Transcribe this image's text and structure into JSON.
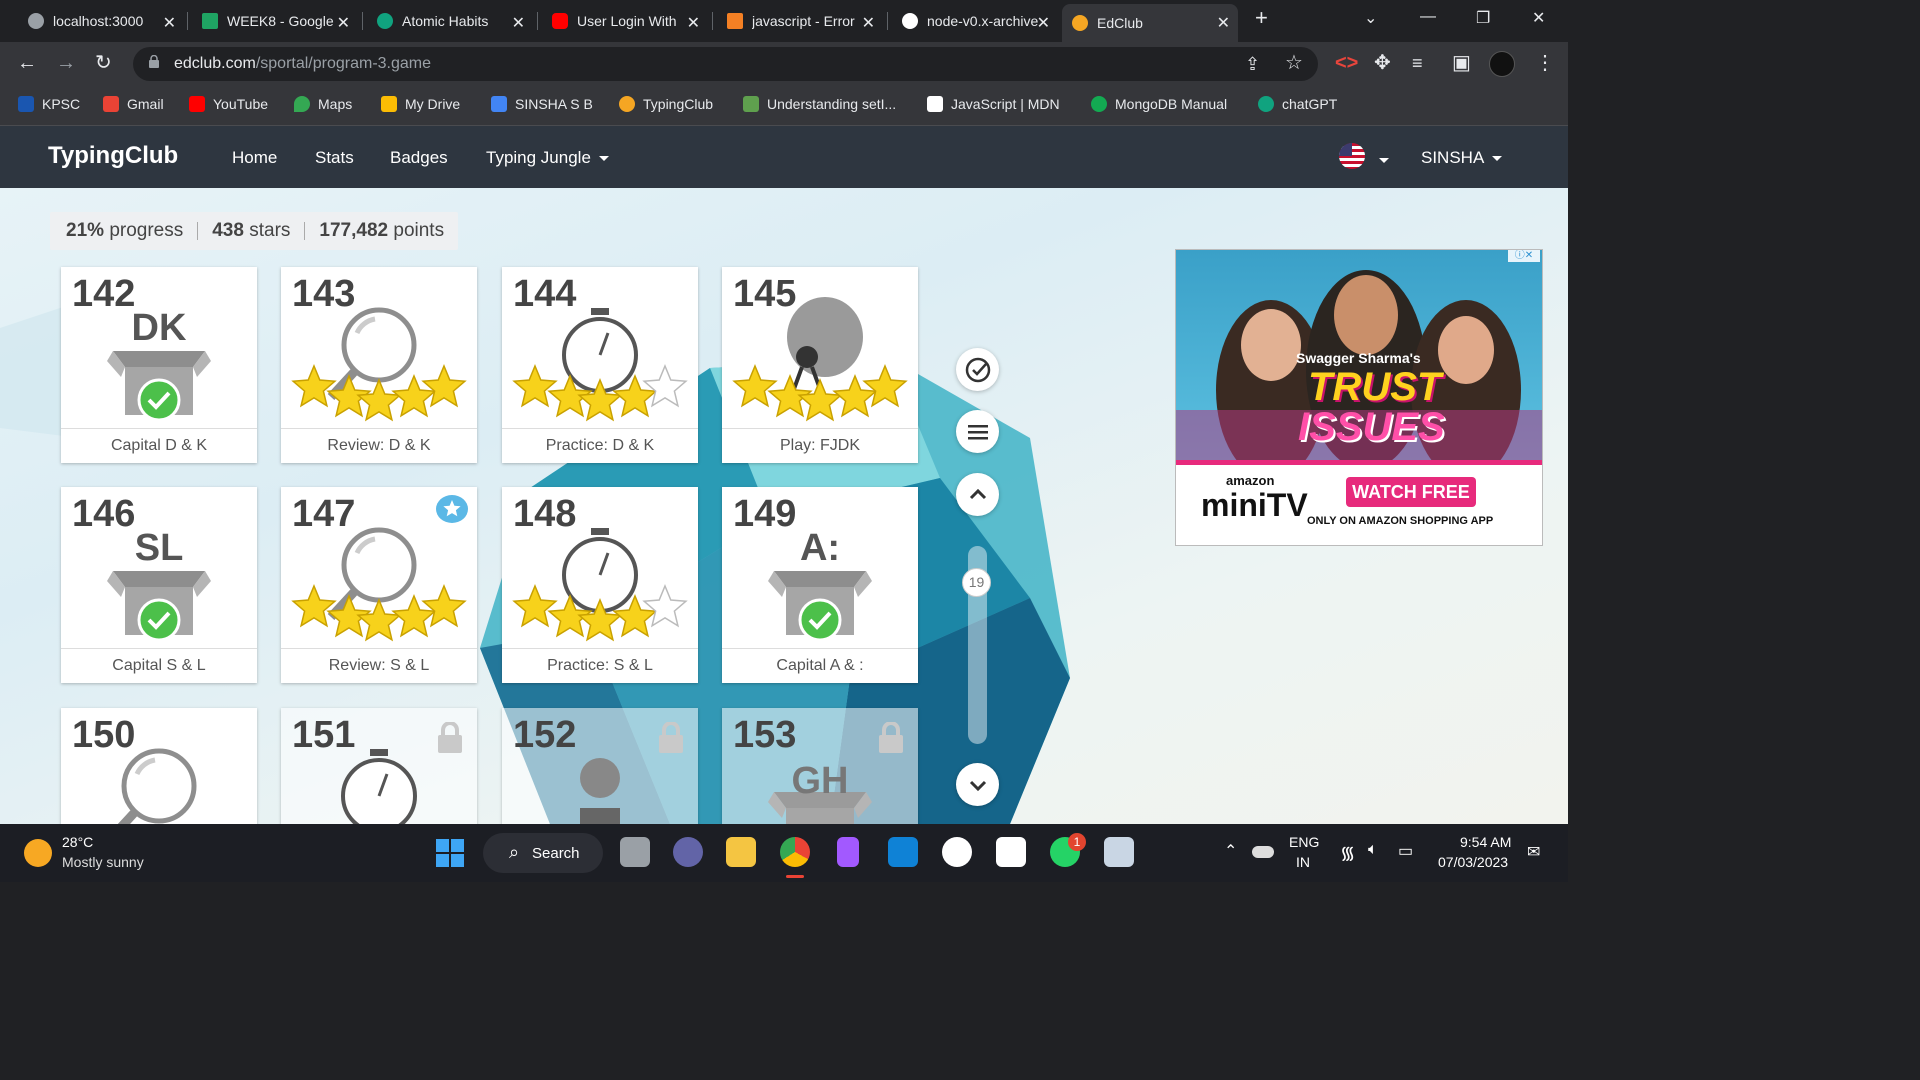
{
  "browser": {
    "tabs": [
      {
        "title": "localhost:3000",
        "color": "#9aa0a6"
      },
      {
        "title": "WEEK8 - Google",
        "color": "#1fa463"
      },
      {
        "title": "Atomic Habits",
        "color": "#10a37f"
      },
      {
        "title": "User Login With",
        "color": "#ff0000"
      },
      {
        "title": "javascript - Error",
        "color": "#f48024"
      },
      {
        "title": "node-v0.x-archive",
        "color": "#ffffff"
      },
      {
        "title": "EdClub",
        "color": "#f5a623"
      }
    ],
    "url_domain": "edclub.com",
    "url_path": "/sportal/program-3.game",
    "bookmarks": [
      {
        "label": "KPSC",
        "color": "#1a56b0"
      },
      {
        "label": "Gmail",
        "color": "#ea4335"
      },
      {
        "label": "YouTube",
        "color": "#ff0000"
      },
      {
        "label": "Maps",
        "color": "#34a853"
      },
      {
        "label": "My Drive",
        "color": "#fbbc04"
      },
      {
        "label": "SINSHA S B",
        "color": "#4285f4"
      },
      {
        "label": "TypingClub",
        "color": "#f5a623"
      },
      {
        "label": "Understanding setI...",
        "color": "#5fa04e"
      },
      {
        "label": "JavaScript | MDN",
        "color": "#ffffff"
      },
      {
        "label": "MongoDB Manual",
        "color": "#13aa52"
      },
      {
        "label": "chatGPT",
        "color": "#10a37f"
      }
    ]
  },
  "site": {
    "logo": "TypingClub",
    "nav": [
      "Home",
      "Stats",
      "Badges",
      "Typing Jungle"
    ],
    "user": "SINSHA"
  },
  "stats": {
    "progress_value": "21%",
    "progress_label": "progress",
    "stars_value": "438",
    "stars_label": "stars",
    "points_value": "177,482",
    "points_label": "points"
  },
  "lessons": [
    {
      "num": "142",
      "title": "Capital D & K",
      "kind": "box",
      "keys": "DK",
      "stars": 0,
      "done": true,
      "locked": false
    },
    {
      "num": "143",
      "title": "Review: D & K",
      "kind": "review",
      "stars": 5,
      "locked": false
    },
    {
      "num": "144",
      "title": "Practice: D & K",
      "kind": "timer",
      "stars": 4,
      "locked": false
    },
    {
      "num": "145",
      "title": "Play: FJDK",
      "kind": "game",
      "stars": 5,
      "locked": false
    },
    {
      "num": "146",
      "title": "Capital S & L",
      "kind": "box",
      "keys": "SL",
      "done": true,
      "locked": false
    },
    {
      "num": "147",
      "title": "Review: S & L",
      "kind": "review",
      "stars": 5,
      "locked": false,
      "badge": true
    },
    {
      "num": "148",
      "title": "Practice: S & L",
      "kind": "timer",
      "stars": 4,
      "locked": false
    },
    {
      "num": "149",
      "title": "Capital A & :",
      "kind": "box",
      "keys": "A:",
      "done": true,
      "locked": false
    },
    {
      "num": "150",
      "title": "",
      "kind": "review",
      "stars": 0,
      "locked": false
    },
    {
      "num": "151",
      "title": "",
      "kind": "timer",
      "stars": 0,
      "locked": true
    },
    {
      "num": "152",
      "title": "",
      "kind": "bear",
      "stars": 0,
      "locked": true
    },
    {
      "num": "153",
      "title": "",
      "kind": "box",
      "keys": "GH",
      "locked": true
    }
  ],
  "scroll_badge": "19",
  "ad": {
    "show_name": "Swagger Sharma's",
    "headline_1": "TRUST",
    "headline_2": "ISSUES",
    "brand_small": "amazon",
    "brand_big": "miniTV",
    "cta": "WATCH FREE",
    "tagline": "ONLY ON AMAZON SHOPPING APP"
  },
  "taskbar": {
    "temperature": "28°C",
    "weather": "Mostly sunny",
    "search": "Search",
    "lang_1": "ENG",
    "lang_2": "IN",
    "time": "9:54 AM",
    "date": "07/03/2023",
    "whatsapp_badge": "1"
  }
}
